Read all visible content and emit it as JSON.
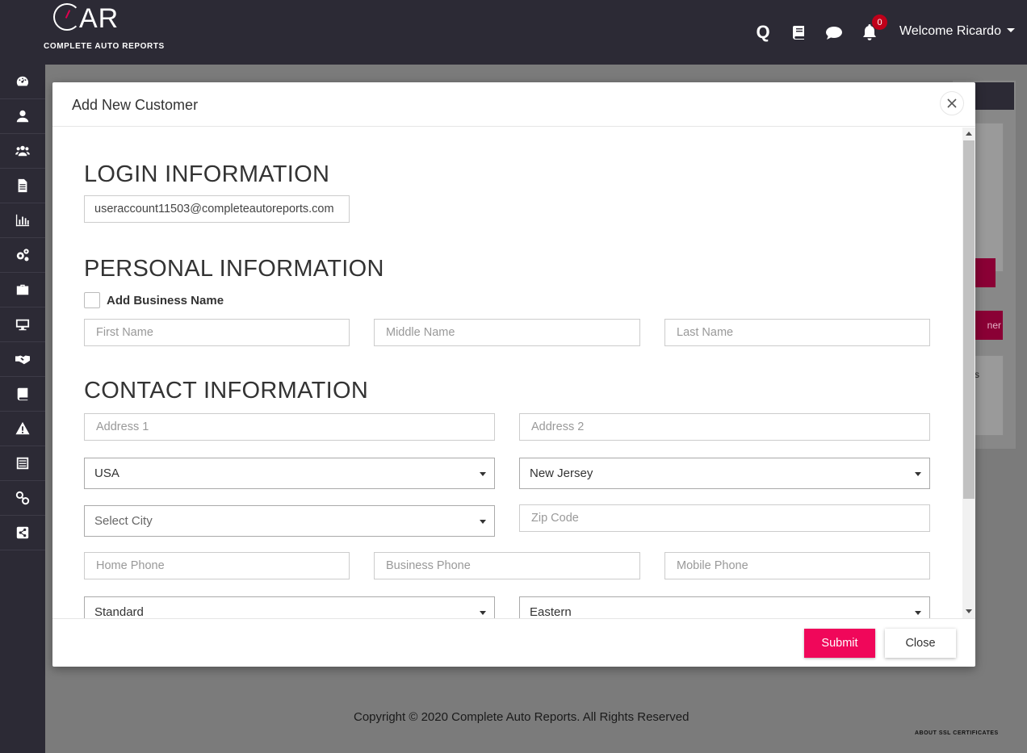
{
  "header": {
    "logo_mark": "AR",
    "logo_text": "COMPLETE AUTO REPORTS",
    "notification_count": "0",
    "welcome": "Welcome Ricardo",
    "icons": [
      "search-q-icon",
      "book-icon",
      "chat-icon",
      "bell-icon"
    ]
  },
  "sidebar": {
    "items": [
      {
        "name": "dashboard-icon"
      },
      {
        "name": "user-icon"
      },
      {
        "name": "users-icon"
      },
      {
        "name": "document-icon"
      },
      {
        "name": "bar-chart-icon"
      },
      {
        "name": "cogs-icon"
      },
      {
        "name": "briefcase-icon"
      },
      {
        "name": "monitor-icon"
      },
      {
        "name": "handshake-icon"
      },
      {
        "name": "book-icon"
      },
      {
        "name": "warning-icon"
      },
      {
        "name": "list-icon"
      },
      {
        "name": "link-icon"
      },
      {
        "name": "share-icon"
      }
    ]
  },
  "background": {
    "button_partial": "ner",
    "list_partial": "s",
    "footer": "Copyright © 2020 Complete Auto Reports. All Rights Reserved",
    "ssl": "ABOUT SSL CERTIFICATES"
  },
  "modal": {
    "title": "Add New Customer",
    "login": {
      "section_title": "LOGIN INFORMATION",
      "username_value": "useraccount11503@completeautoreports.com"
    },
    "personal": {
      "section_title": "PERSONAL INFORMATION",
      "business_checkbox_label": "Add Business Name",
      "first_name_placeholder": "First Name",
      "middle_name_placeholder": "Middle Name",
      "last_name_placeholder": "Last Name"
    },
    "contact": {
      "section_title": "CONTACT INFORMATION",
      "address1_placeholder": "Address 1",
      "address2_placeholder": "Address 2",
      "country_selected": "USA",
      "state_selected": "New Jersey",
      "city_placeholder": "Select City",
      "zip_placeholder": "Zip Code",
      "home_phone_placeholder": "Home Phone",
      "business_phone_placeholder": "Business Phone",
      "mobile_phone_placeholder": "Mobile Phone",
      "time_standard_selected": "Standard",
      "timezone_selected": "Eastern"
    },
    "footer": {
      "submit_label": "Submit",
      "close_label": "Close"
    }
  },
  "colors": {
    "header_bg": "#2c2a35",
    "accent": "#f0075a",
    "badge": "#c0001a"
  }
}
